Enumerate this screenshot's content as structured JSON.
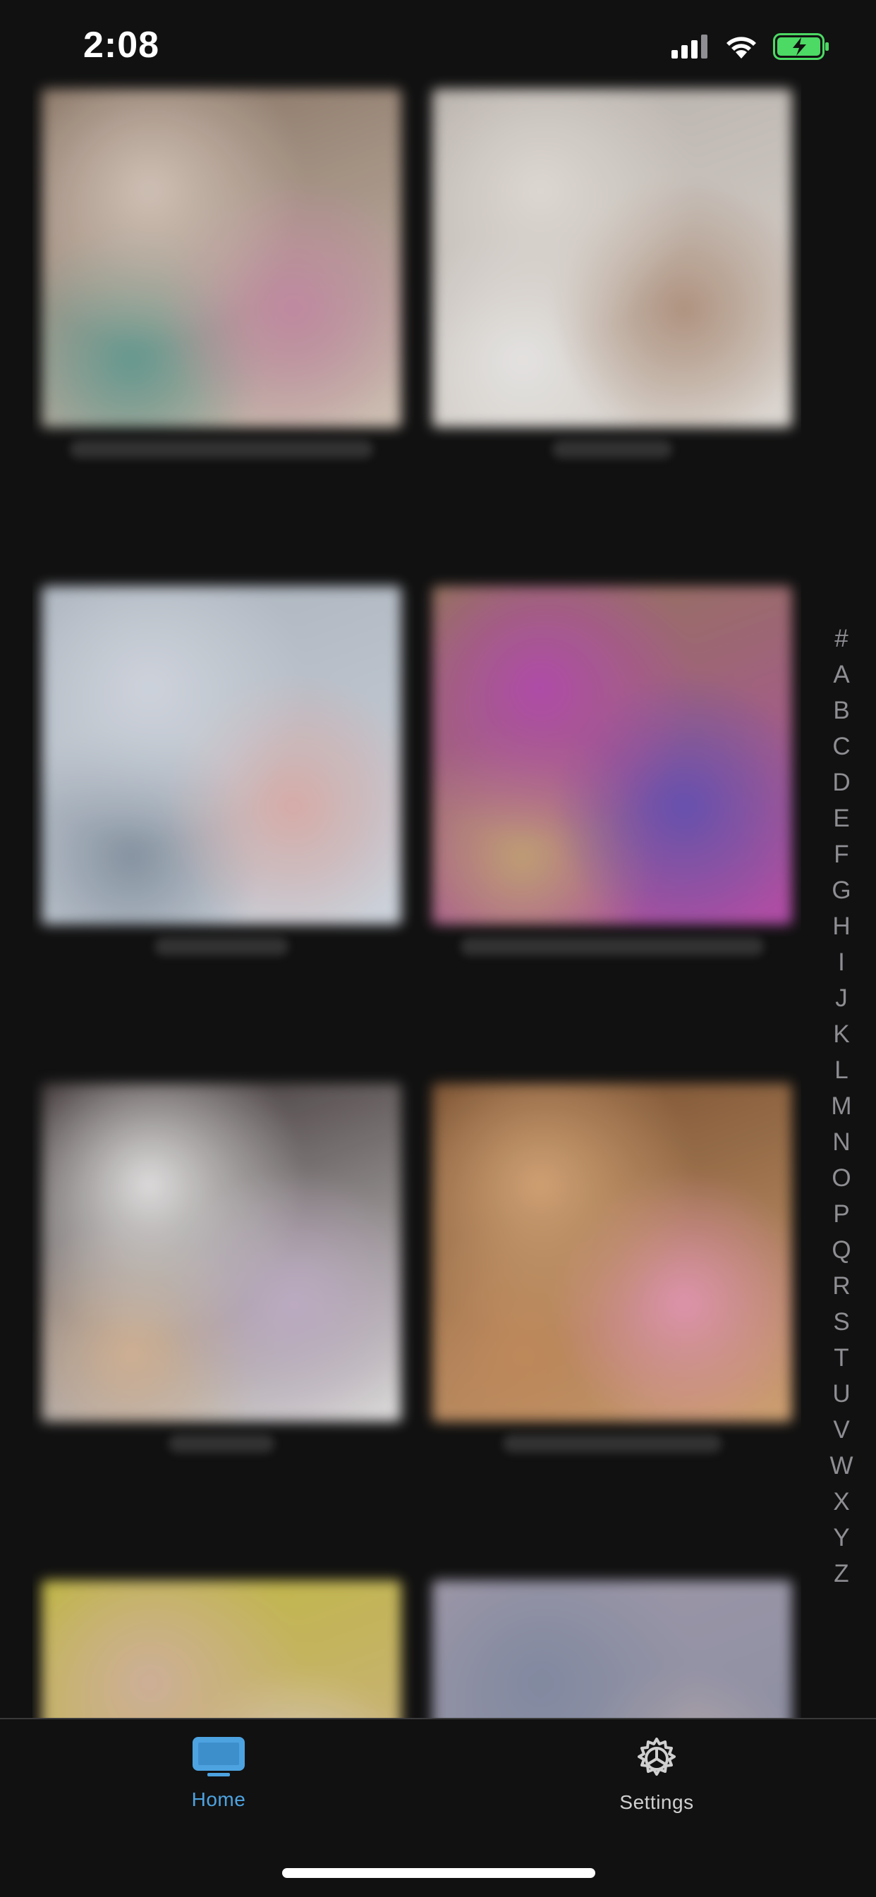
{
  "status_bar": {
    "time": "2:08",
    "icons": [
      "cellular-signal-icon",
      "wifi-icon",
      "battery-charging-icon"
    ],
    "battery_color": "#4cd964"
  },
  "grid": {
    "tiles": [
      {
        "colors": [
          "#8c7766",
          "#d9c9bd",
          "#c98fa8",
          "#6aa095"
        ]
      },
      {
        "colors": [
          "#bfb8b2",
          "#e8e2dc",
          "#b89a86",
          "#f0eeec"
        ]
      },
      {
        "colors": [
          "#b4bcc6",
          "#d7dde6",
          "#e1b4b0",
          "#8c9aa8"
        ]
      },
      {
        "colors": [
          "#9a7b5c",
          "#b84fb0",
          "#6a54b8",
          "#c9a57a"
        ]
      },
      {
        "colors": [
          "#3a3030",
          "#e8e6e6",
          "#c6b4cc",
          "#d8b89a"
        ]
      },
      {
        "colors": [
          "#7a5030",
          "#d9a878",
          "#e89ab4",
          "#c89060"
        ]
      },
      {
        "colors": [
          "#c8c040",
          "#d8b8a0",
          "#e8d8d8",
          "#d8a8c8"
        ]
      },
      {
        "colors": [
          "#a8a0b0",
          "#8890a8",
          "#c8b8b0",
          "#b0a8b8"
        ]
      }
    ]
  },
  "index_bar": {
    "letters": [
      "#",
      "A",
      "B",
      "C",
      "D",
      "E",
      "F",
      "G",
      "H",
      "I",
      "J",
      "K",
      "L",
      "M",
      "N",
      "O",
      "P",
      "Q",
      "R",
      "S",
      "T",
      "U",
      "V",
      "W",
      "X",
      "Y",
      "Z"
    ]
  },
  "tab_bar": {
    "accent_color": "#4da3e0",
    "home": {
      "label": "Home",
      "icon": "tv-icon"
    },
    "settings": {
      "label": "Settings",
      "icon": "gear-icon"
    }
  }
}
